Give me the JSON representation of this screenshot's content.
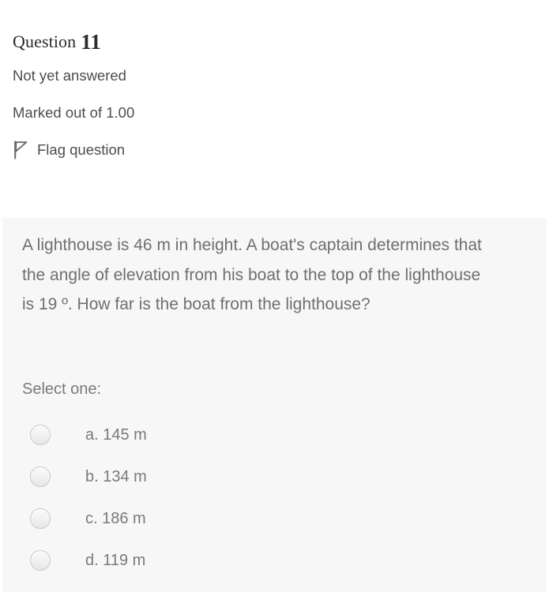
{
  "question": {
    "label": "Question",
    "number": "11",
    "state": "Not yet answered",
    "grade": "Marked out of 1.00",
    "flag": {
      "icon": "flag-icon",
      "label": "Flag question"
    },
    "body": "A lighthouse is 46 m in height. A boat's captain determines that  the angle of elevation from his boat to the top of the lighthouse is 19 º. How far is the boat from the lighthouse?",
    "answers_intro": "Select one:",
    "options": [
      {
        "key": "a.",
        "text": "145 m",
        "label": "a. 145 m",
        "selected": false
      },
      {
        "key": "b.",
        "text": "134 m",
        "label": "b. 134 m",
        "selected": false
      },
      {
        "key": "c.",
        "text": "186 m",
        "label": "c. 186 m",
        "selected": false
      },
      {
        "key": "d.",
        "text": "119 m",
        "label": "d. 119 m",
        "selected": false
      }
    ]
  },
  "colors": {
    "page_background": "#ffffff",
    "panel_background": "#f7f7f7",
    "heading_text": "#2b2b2b",
    "meta_text": "#4d4d4d",
    "body_text": "#6f6f6f",
    "option_text": "#7a7a7a",
    "radio_border": "#c9c9c9"
  }
}
